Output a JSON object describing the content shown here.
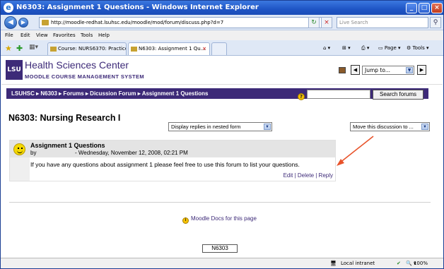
{
  "window": {
    "title": "N6303: Assignment 1 Questions - Windows Internet Explorer",
    "min": "_",
    "max": "□",
    "close": "×"
  },
  "address": {
    "url": "http://moodle-redhat.lsuhsc.edu/moodle/mod/forum/discuss.php?d=7",
    "search_placeholder": "Live Search"
  },
  "menu": [
    "File",
    "Edit",
    "View",
    "Favorites",
    "Tools",
    "Help"
  ],
  "tabs": [
    {
      "label": "Course: NURS6370: Practice ..."
    },
    {
      "label": "N6303: Assignment 1 Qu..."
    }
  ],
  "toolbar": {
    "page": "Page",
    "tools": "Tools"
  },
  "header": {
    "logo": "LSU",
    "title": "Health Sciences Center",
    "subtitle": "MOODLE COURSE MANAGEMENT SYSTEM",
    "jump_label": "Jump to..."
  },
  "nav": {
    "breadcrumb": "LSUHSC ▸ N6303 ▸ Forums ▸ Dicussion Forum ▸ Assignment 1 Questions",
    "search_button": "Search forums"
  },
  "page": {
    "title": "N6303: Nursing Research I",
    "display_select": "Display replies in nested form",
    "move_select": "Move this discussion to ..."
  },
  "post": {
    "subject": "Assignment 1 Questions",
    "by": "by",
    "date": "- Wednesday, November 12, 2008, 02:21 PM",
    "message": "If you have any questions about assignment 1 please feel free to use this forum to list your questions.",
    "edit": "Edit",
    "delete": "Delete",
    "reply": "Reply",
    "sep": " | "
  },
  "footer": {
    "docs_link": "Moodle Docs for this page",
    "course_button": "N6303"
  },
  "status": {
    "zone": "Local intranet",
    "zoom": "100%"
  },
  "colors": {
    "brand": "#3d2a78",
    "titlebar": "#1f55c5",
    "arrow": "#e8532a"
  }
}
